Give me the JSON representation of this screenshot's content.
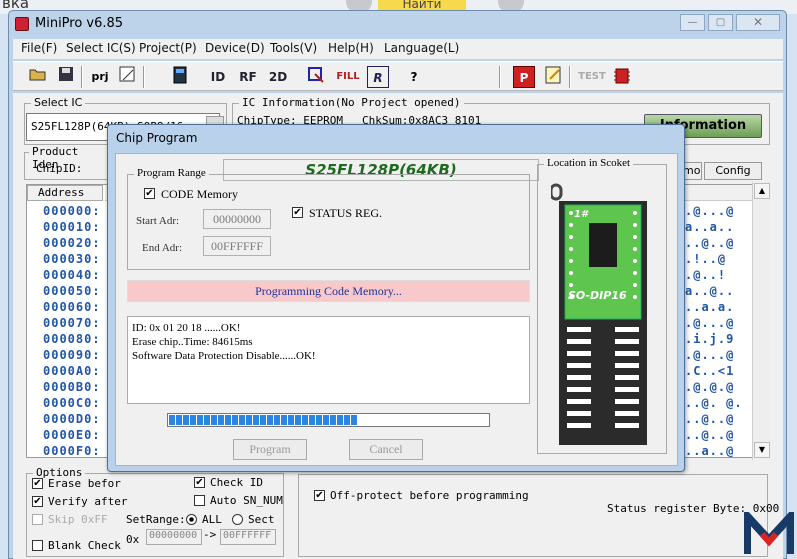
{
  "background": {
    "word": "вка",
    "search_label": "Найти"
  },
  "window": {
    "title": "MiniPro v6.85",
    "btn_min": "—",
    "btn_max": "▢",
    "btn_close": "✕"
  },
  "menu": [
    "File(F)",
    "Select IC(S)",
    "Project(P)",
    "Device(D)",
    "Tools(V)",
    "Help(H)",
    "Language(L)"
  ],
  "toolbar": {
    "prj": "prj",
    "id": "ID",
    "rf": "RF",
    "two_d": "2D",
    "fill": "FILL",
    "r": "R",
    "help": "?",
    "p": "P",
    "test": "TEST"
  },
  "select_ic": {
    "label": "Select IC",
    "value": "S25FL128P(64KB) SOP8/16"
  },
  "ic_info": {
    "label": "IC Information(No Project opened)",
    "chip_type": "ChipType: EEPROM",
    "chksum": "ChkSum:0x8AC3 8101",
    "info_button": "Information"
  },
  "product": {
    "label": "Product Iden",
    "chip_id": "ChipID:"
  },
  "buffer": {
    "header": "Address",
    "addresses": [
      "000000:",
      "000010:",
      "000020:",
      "000030:",
      "000040:",
      "000050:",
      "000060:",
      "000070:",
      "000080:",
      "000090:",
      "0000A0:",
      "0000B0:",
      "0000C0:",
      "0000D0:",
      "0000E0:",
      "0000F0:"
    ],
    "ascii": [
      ".@...@",
      "a..a..",
      "..@..@",
      ".!..@",
      ".@..!",
      "a..@..",
      "..a.a.",
      ".@...@",
      ".i.j.9",
      ".@...@",
      ".C..<1",
      ".@.@.@",
      "..@. @.",
      "..@..@",
      "..@..@",
      "..a..@"
    ]
  },
  "right_buttons": {
    "demo": "mo",
    "config": "Config"
  },
  "options": {
    "label": "Options",
    "erase_before": "Erase befor",
    "verify_after": "Verify after",
    "skip_0xff": "Skip 0xFF",
    "blank_check": "Blank Check",
    "check_id": "Check ID",
    "auto_sn": "Auto SN_NUM",
    "setrange": "SetRange:",
    "all": "ALL",
    "sect": "Sect",
    "ox": "0x",
    "range_start": "00000000",
    "arrow": "->",
    "range_end": "00FFFFFF",
    "off_protect": "Off-protect before programming",
    "status_register": "Status register Byte: 0x00"
  },
  "dialog": {
    "title": "Chip Program",
    "chip_name": "S25FL128P(64KB)",
    "program_range_label": "Program Range",
    "code_memory": "CODE Memory",
    "status_reg": "STATUS REG.",
    "start_adr_label": "Start Adr:",
    "start_adr": "00000000",
    "end_adr_label": "End Adr:",
    "end_adr": "00FFFFFF",
    "status_message": "Programming Code Memory...",
    "log": [
      "ID: 0x 01 20 18 ......OK!",
      "Erase chip..Time: 84615ms",
      "Software Data Protection Disable......OK!"
    ],
    "progress": 0.59,
    "program_button": "Program",
    "cancel_button": "Cancel",
    "location_label": "Location in Scoket",
    "chip_pin1": "1#",
    "chip_package": "SO-DIP16"
  },
  "watermark": "M"
}
